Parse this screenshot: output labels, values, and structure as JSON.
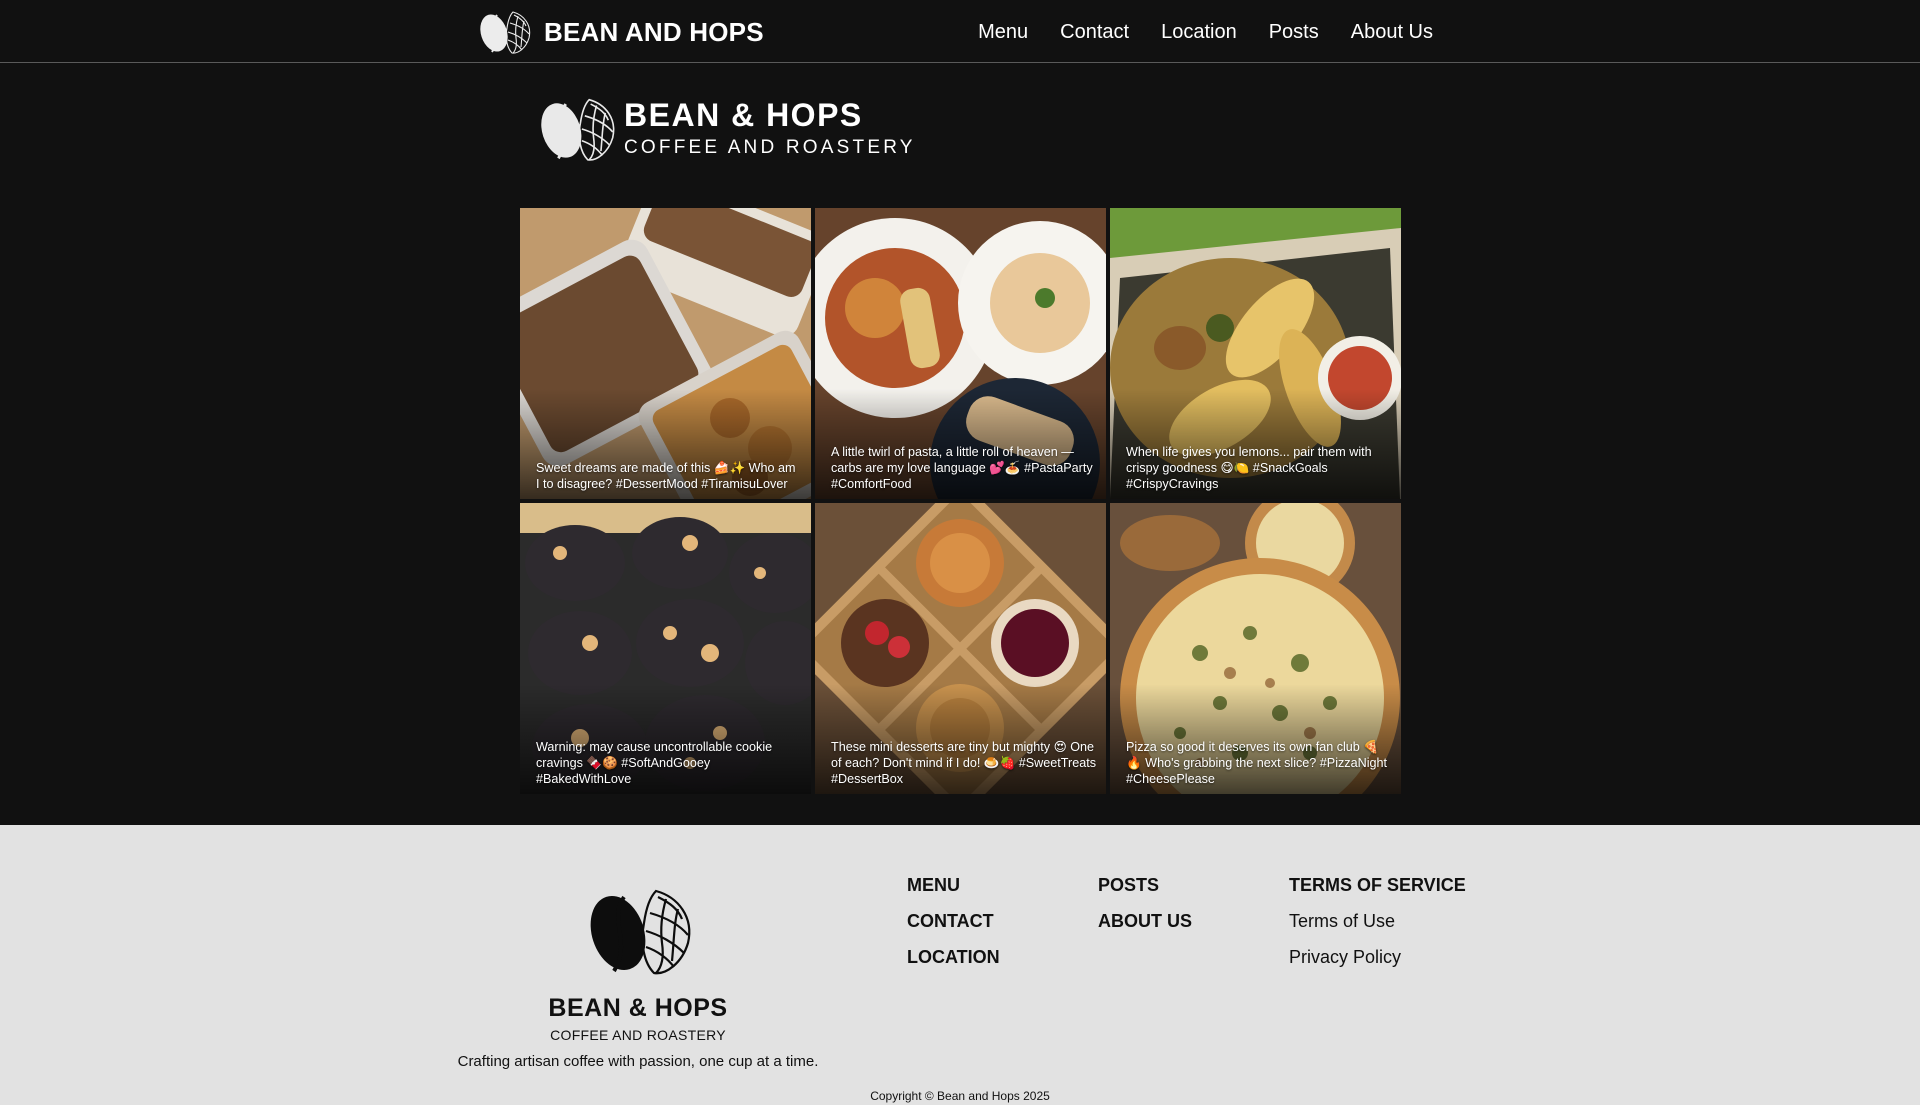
{
  "header": {
    "brand_name": "BEAN AND HOPS",
    "nav": [
      "Menu",
      "Contact",
      "Location",
      "Posts",
      "About Us"
    ]
  },
  "hero": {
    "title": "BEAN & HOPS",
    "subtitle": "COFFEE AND ROASTERY"
  },
  "posts": [
    {
      "caption": "Sweet dreams are made of this 🍰✨ Who am I to disagree? #DessertMood #TiramisuLover",
      "icon": "tiramisu-photo"
    },
    {
      "caption": "A little twirl of pasta, a little roll of heaven — carbs are my love language 💕🍝 #PastaParty #ComfortFood",
      "icon": "pasta-photo"
    },
    {
      "caption": "When life gives you lemons... pair them with crispy goodness 😋🍋 #SnackGoals #CrispyCravings",
      "icon": "fries-photo"
    },
    {
      "caption": "Warning: may cause uncontrollable cookie cravings 🍫🍪 #SoftAndGooey #BakedWithLove",
      "icon": "cookies-photo"
    },
    {
      "caption": "These mini desserts are tiny but mighty 😍 One of each? Don't mind if I do! 🍮🍓 #SweetTreats #DessertBox",
      "icon": "dessert-box-photo"
    },
    {
      "caption": "Pizza so good it deserves its own fan club 🍕🔥 Who's grabbing the next slice? #PizzaNight #CheesePlease",
      "icon": "pizza-photo"
    }
  ],
  "footer": {
    "title": "BEAN & HOPS",
    "subtitle": "COFFEE AND ROASTERY",
    "tagline": "Crafting artisan coffee with passion, one cup at a time.",
    "col1": [
      "MENU",
      "CONTACT",
      "LOCATION"
    ],
    "col2": [
      "POSTS",
      "ABOUT US"
    ],
    "col3_heading": "TERMS OF SERVICE",
    "col3": [
      "Terms of Use",
      "Privacy Policy"
    ],
    "copyright": "Copyright © Bean and Hops 2025"
  },
  "colors": {
    "background": "#111111",
    "footer": "#e2e2e2",
    "text_light": "#ffffff",
    "text_dark": "#111111"
  }
}
